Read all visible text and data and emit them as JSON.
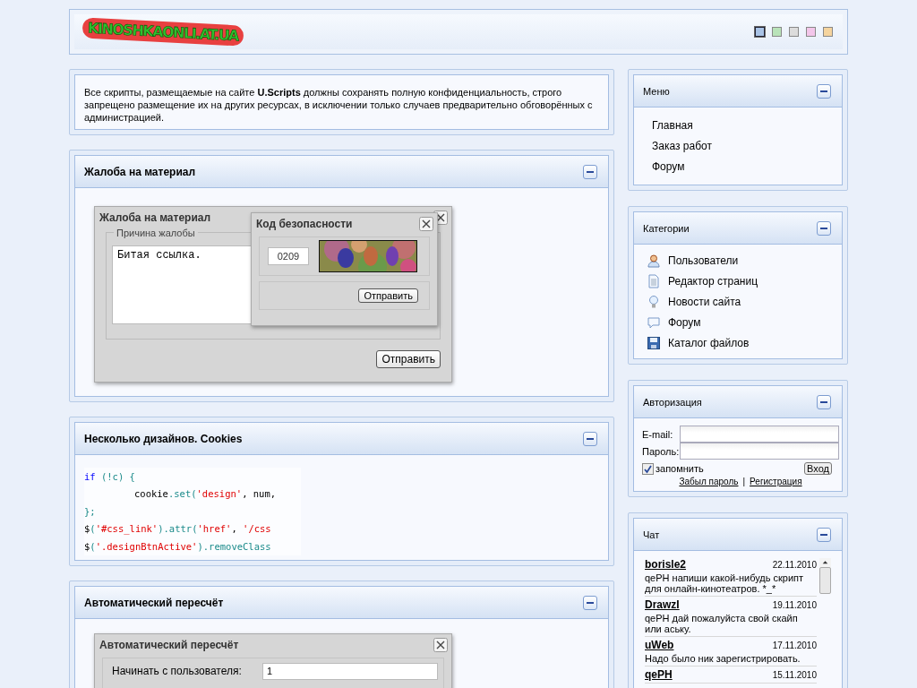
{
  "header": {
    "logo": "KINOSHKAONLI.AT.UA",
    "design_switcher": [
      {
        "color": "#a9c3e6",
        "selected": true
      },
      {
        "color": "#b9e3b9",
        "selected": false
      },
      {
        "color": "#dcdcdc",
        "selected": false
      },
      {
        "color": "#f3c6ea",
        "selected": false
      },
      {
        "color": "#f5d49e",
        "selected": false
      }
    ]
  },
  "notice": {
    "text": "Все скрипты, размещаемые на сайте **U.Scripts** должны сохранять полную конфиденциальность, строго запрещено размещение их на других ресурсах, в исключении только случаев предварительно обговорённых с администрацией."
  },
  "complaint_panel": {
    "title": "Жалоба на материал",
    "dialog": {
      "title": "Жалоба на материал",
      "legend": "Причина жалобы",
      "reason": "Битая ссылка.",
      "button": "Отправить"
    },
    "captcha_dialog": {
      "title": "Код безопасности",
      "code": "0209",
      "button": "Отправить"
    }
  },
  "design_panel": {
    "title": "Несколько дизайнов. Cookies",
    "code_lines": [
      {
        "indent": false,
        "tokens": [
          {
            "kind": "keyword",
            "text": "if"
          },
          {
            "kind": "punct",
            "text": " (!c) {"
          }
        ]
      },
      {
        "indent": true,
        "tokens": [
          {
            "kind": "plain",
            "text": "cookie"
          },
          {
            "kind": "method",
            "text": ".set("
          },
          {
            "kind": "string",
            "text": "'design'"
          },
          {
            "kind": "plain",
            "text": ", num,"
          }
        ]
      },
      {
        "indent": false,
        "tokens": [
          {
            "kind": "punct",
            "text": "};"
          }
        ]
      },
      {
        "indent": false,
        "tokens": [
          {
            "kind": "plain",
            "text": "$"
          },
          {
            "kind": "punct",
            "text": "("
          },
          {
            "kind": "string",
            "text": "'#css_link'"
          },
          {
            "kind": "method",
            "text": ").attr("
          },
          {
            "kind": "string",
            "text": "'href'"
          },
          {
            "kind": "plain",
            "text": ", "
          },
          {
            "kind": "string",
            "text": "'/css"
          }
        ]
      },
      {
        "indent": false,
        "tokens": [
          {
            "kind": "plain",
            "text": "$"
          },
          {
            "kind": "punct",
            "text": "("
          },
          {
            "kind": "string",
            "text": "'.designBtnActive'"
          },
          {
            "kind": "method",
            "text": ").removeClass"
          }
        ]
      }
    ]
  },
  "recalc_panel": {
    "title": "Автоматический пересчёт",
    "dialog": {
      "title": "Автоматический пересчёт",
      "fields": [
        {
          "label": "Начинать с пользователя:",
          "value": "1"
        }
      ]
    }
  },
  "sidebar": {
    "menu": {
      "title": "Меню",
      "items": [
        "Главная",
        "Заказ работ",
        "Форум"
      ]
    },
    "categories": {
      "title": "Категории",
      "items": [
        {
          "kind": "user",
          "label": "Пользователи"
        },
        {
          "kind": "page",
          "label": "Редактор страниц"
        },
        {
          "kind": "bulb",
          "label": "Новости сайта"
        },
        {
          "kind": "bubble",
          "label": "Форум"
        },
        {
          "kind": "disk",
          "label": "Каталог файлов"
        }
      ]
    },
    "login": {
      "title": "Авторизация",
      "email_label": "E-mail:",
      "password_label": "Пароль:",
      "remember": {
        "label": "запомнить",
        "checked": true
      },
      "button": "Вход",
      "forgot": "Забыл пароль",
      "separator": "|",
      "register": "Регистрация"
    },
    "chat": {
      "title": "Чат",
      "messages": [
        {
          "author": "borisle2",
          "date": "22.11.2010",
          "text": "qePH напиши какой-нибудь скрипт для онлайн-кинотеатров. *_*"
        },
        {
          "author": "DrawzI",
          "date": "19.11.2010",
          "text": "qePH дай пожалуйста свой скайп или аську."
        },
        {
          "author": "uWeb",
          "date": "17.11.2010",
          "text": "Надо было ник зарегистрировать."
        },
        {
          "author": "qePH",
          "date": "15.11.2010"
        }
      ]
    }
  }
}
